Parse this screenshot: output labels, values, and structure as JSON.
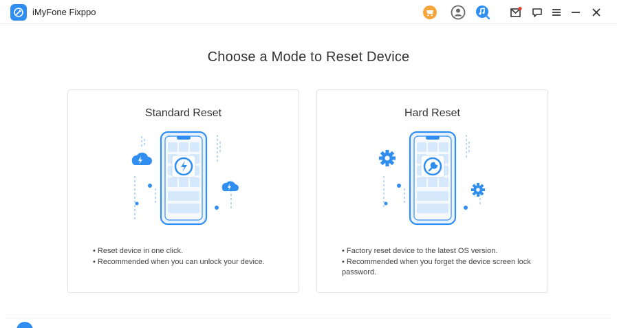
{
  "app": {
    "title": "iMyFone Fixppo",
    "icons": [
      "app-logo-icon",
      "cart-icon",
      "user-icon",
      "music-search-icon",
      "mail-icon",
      "feedback-icon",
      "menu-icon",
      "minimize-icon",
      "close-icon"
    ],
    "accent": "#2f8ef0",
    "cart_color": "#f5a53c"
  },
  "main": {
    "title": "Choose a Mode to Reset Device"
  },
  "cards": [
    {
      "title": "Standard Reset",
      "bullets": [
        "• Reset device in one click.",
        "• Recommended when you can unlock your device."
      ]
    },
    {
      "title": "Hard Reset",
      "bullets": [
        "• Factory reset device to the latest OS version.",
        "• Recommended when you forget the device screen lock password."
      ]
    }
  ]
}
